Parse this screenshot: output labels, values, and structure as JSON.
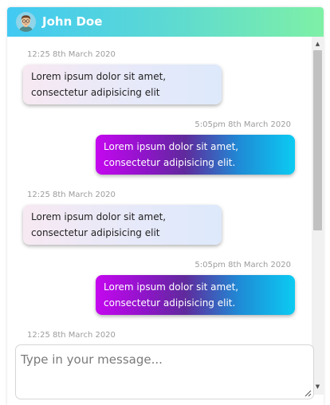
{
  "header": {
    "contact_name": "John Doe",
    "avatar_icon": "man-with-glasses-avatar"
  },
  "messages": [
    {
      "direction": "received",
      "timestamp": "12:25 8th March 2020",
      "text": "Lorem ipsum dolor sit amet, consectetur adipisicing elit"
    },
    {
      "direction": "sent",
      "timestamp": "5:05pm 8th March 2020",
      "text": "Lorem ipsum dolor sit amet, consectetur adipisicing elit."
    },
    {
      "direction": "received",
      "timestamp": "12:25 8th March 2020",
      "text": "Lorem ipsum dolor sit amet, consectetur adipisicing elit"
    },
    {
      "direction": "sent",
      "timestamp": "5:05pm 8th March 2020",
      "text": "Lorem ipsum dolor sit amet, consectetur adipisicing elit."
    },
    {
      "direction": "received",
      "timestamp": "12:25 8th March 2020",
      "text": ""
    }
  ],
  "composer": {
    "placeholder": "Type in your message...",
    "value": ""
  },
  "colors": {
    "header_gradient": [
      "#42c9f3",
      "#7ef0a6"
    ],
    "sent_gradient": [
      "#c507ef",
      "#0bcbf2"
    ],
    "received_gradient": [
      "#f7e9f2",
      "#dde9fb"
    ]
  }
}
